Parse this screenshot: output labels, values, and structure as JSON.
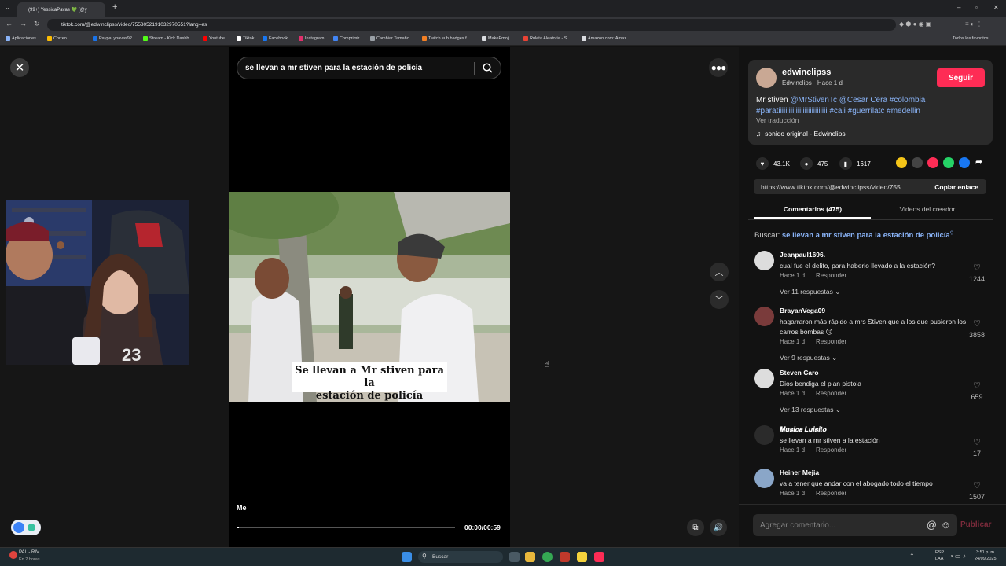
{
  "browser": {
    "tab_title": "(99+) YessicaPavas 💚 (@y",
    "url": "tiktok.com/@edwinclipss/video/7553052191032970551?lang=es",
    "bookmarks": [
      {
        "label": "Aplicaciones",
        "icon_color": "#8ab4f8"
      },
      {
        "label": "Correo",
        "icon_color": "#fbbc04"
      },
      {
        "label": "Paypal ypavas92",
        "icon_color": "#1a73e8"
      },
      {
        "label": "Stream - Kick Dashb...",
        "icon_color": "#53fc18"
      },
      {
        "label": "Youtube",
        "icon_color": "#ff0000"
      },
      {
        "label": "Tiktok",
        "icon_color": "#ffffff"
      },
      {
        "label": "Facebook",
        "icon_color": "#1877f2"
      },
      {
        "label": "Instagram",
        "icon_color": "#e1306c"
      },
      {
        "label": "Comprimir",
        "icon_color": "#4285f4"
      },
      {
        "label": "Cambiar Tamaño",
        "icon_color": "#9aa0a6"
      },
      {
        "label": "Twitch sub badges f...",
        "icon_color": "#f48024"
      },
      {
        "label": "MakeEmoji",
        "icon_color": "#dadce0"
      },
      {
        "label": "Ruleta Aleatoria - S...",
        "icon_color": "#ea4335"
      },
      {
        "label": "Amazon.com: Amaz...",
        "icon_color": "#dadce0"
      }
    ],
    "all_bookmarks": "Todos los favoritos"
  },
  "video": {
    "search_query": "se llevan a mr stiven para la estación de policía",
    "caption_line1": "Se llevan a Mr stiven para la",
    "caption_line2": "estación de policía",
    "music_label": "Me",
    "time": "00:00/00:59",
    "progress": 0.01
  },
  "post": {
    "username": "edwinclipss",
    "subtitle": "Edwinclips · Hace 1 d",
    "follow_label": "Seguir",
    "description_text": "Mr stiven ",
    "description_tags": "@MrStivenTc @Cesar Cera #colombia #paratiiiiiiiiiiiiiiiiiiiiiiiiiiii #cali #guerrilatc #medellin",
    "translate": "Ver traducción",
    "sound": "sonido original - Edwinclips",
    "likes": "43.1K",
    "comments": "475",
    "saves": "1617",
    "link": "https://www.tiktok.com/@edwinclipss/video/755...",
    "copy_link": "Copiar enlace",
    "tab_comments": "Comentarios (475)",
    "tab_creator": "Videos del creador",
    "search_prefix": "Buscar: ",
    "search_term": "se llevan a mr stiven para la estación de policía",
    "share_colors": [
      "#f5c518",
      "#444444",
      "#fe2c55",
      "#25d366",
      "#1877f2"
    ]
  },
  "comments": [
    {
      "name": "Jeanpaul1696.",
      "text": "cual fue el delito, para haberio llevado a la estación?",
      "time": "Hace 1 d",
      "reply": "Responder",
      "likes": "1244",
      "replies": "Ver 11 respuestas ⌄",
      "avatar_color": "#dddddd"
    },
    {
      "name": "BrayanVega09",
      "text": "hagarraron más rápido a mrs Stiven que a los que pusieron los carros bombas 😕",
      "time": "Hace 1 d",
      "reply": "Responder",
      "likes": "3858",
      "replies": "Ver 9 respuestas ⌄",
      "avatar_color": "#7a3b3b"
    },
    {
      "name": "Steven Caro",
      "text": "Dios bendiga el plan pistola",
      "time": "Hace 1 d",
      "reply": "Responder",
      "likes": "659",
      "replies": "Ver 13 respuestas ⌄",
      "avatar_color": "#dddddd"
    },
    {
      "name": "𝑴𝒖𝒔𝒊𝒄𝒂 𝑳𝒖𝒊𝒔𝒊𝒕𝒐",
      "text": "se llevan a mr stiven a la estación",
      "time": "Hace 1 d",
      "reply": "Responder",
      "likes": "17",
      "replies": "",
      "avatar_color": "#2b2b2b"
    },
    {
      "name": "Heiner Mejia",
      "text": "va a tener que andar con el abogado todo el tiempo",
      "time": "Hace 1 d",
      "reply": "Responder",
      "likes": "1507",
      "replies": "",
      "avatar_color": "#8aa6c8"
    }
  ],
  "compose": {
    "placeholder": "Agregar comentario...",
    "publish": "Publicar"
  },
  "taskbar": {
    "weather_title": "PAL - RIV",
    "weather_sub": "En 2 horas",
    "search": "Buscar",
    "lang": "ESP",
    "lang2": "LAA",
    "time": "3:51 p. m.",
    "date": "24/09/2025"
  }
}
